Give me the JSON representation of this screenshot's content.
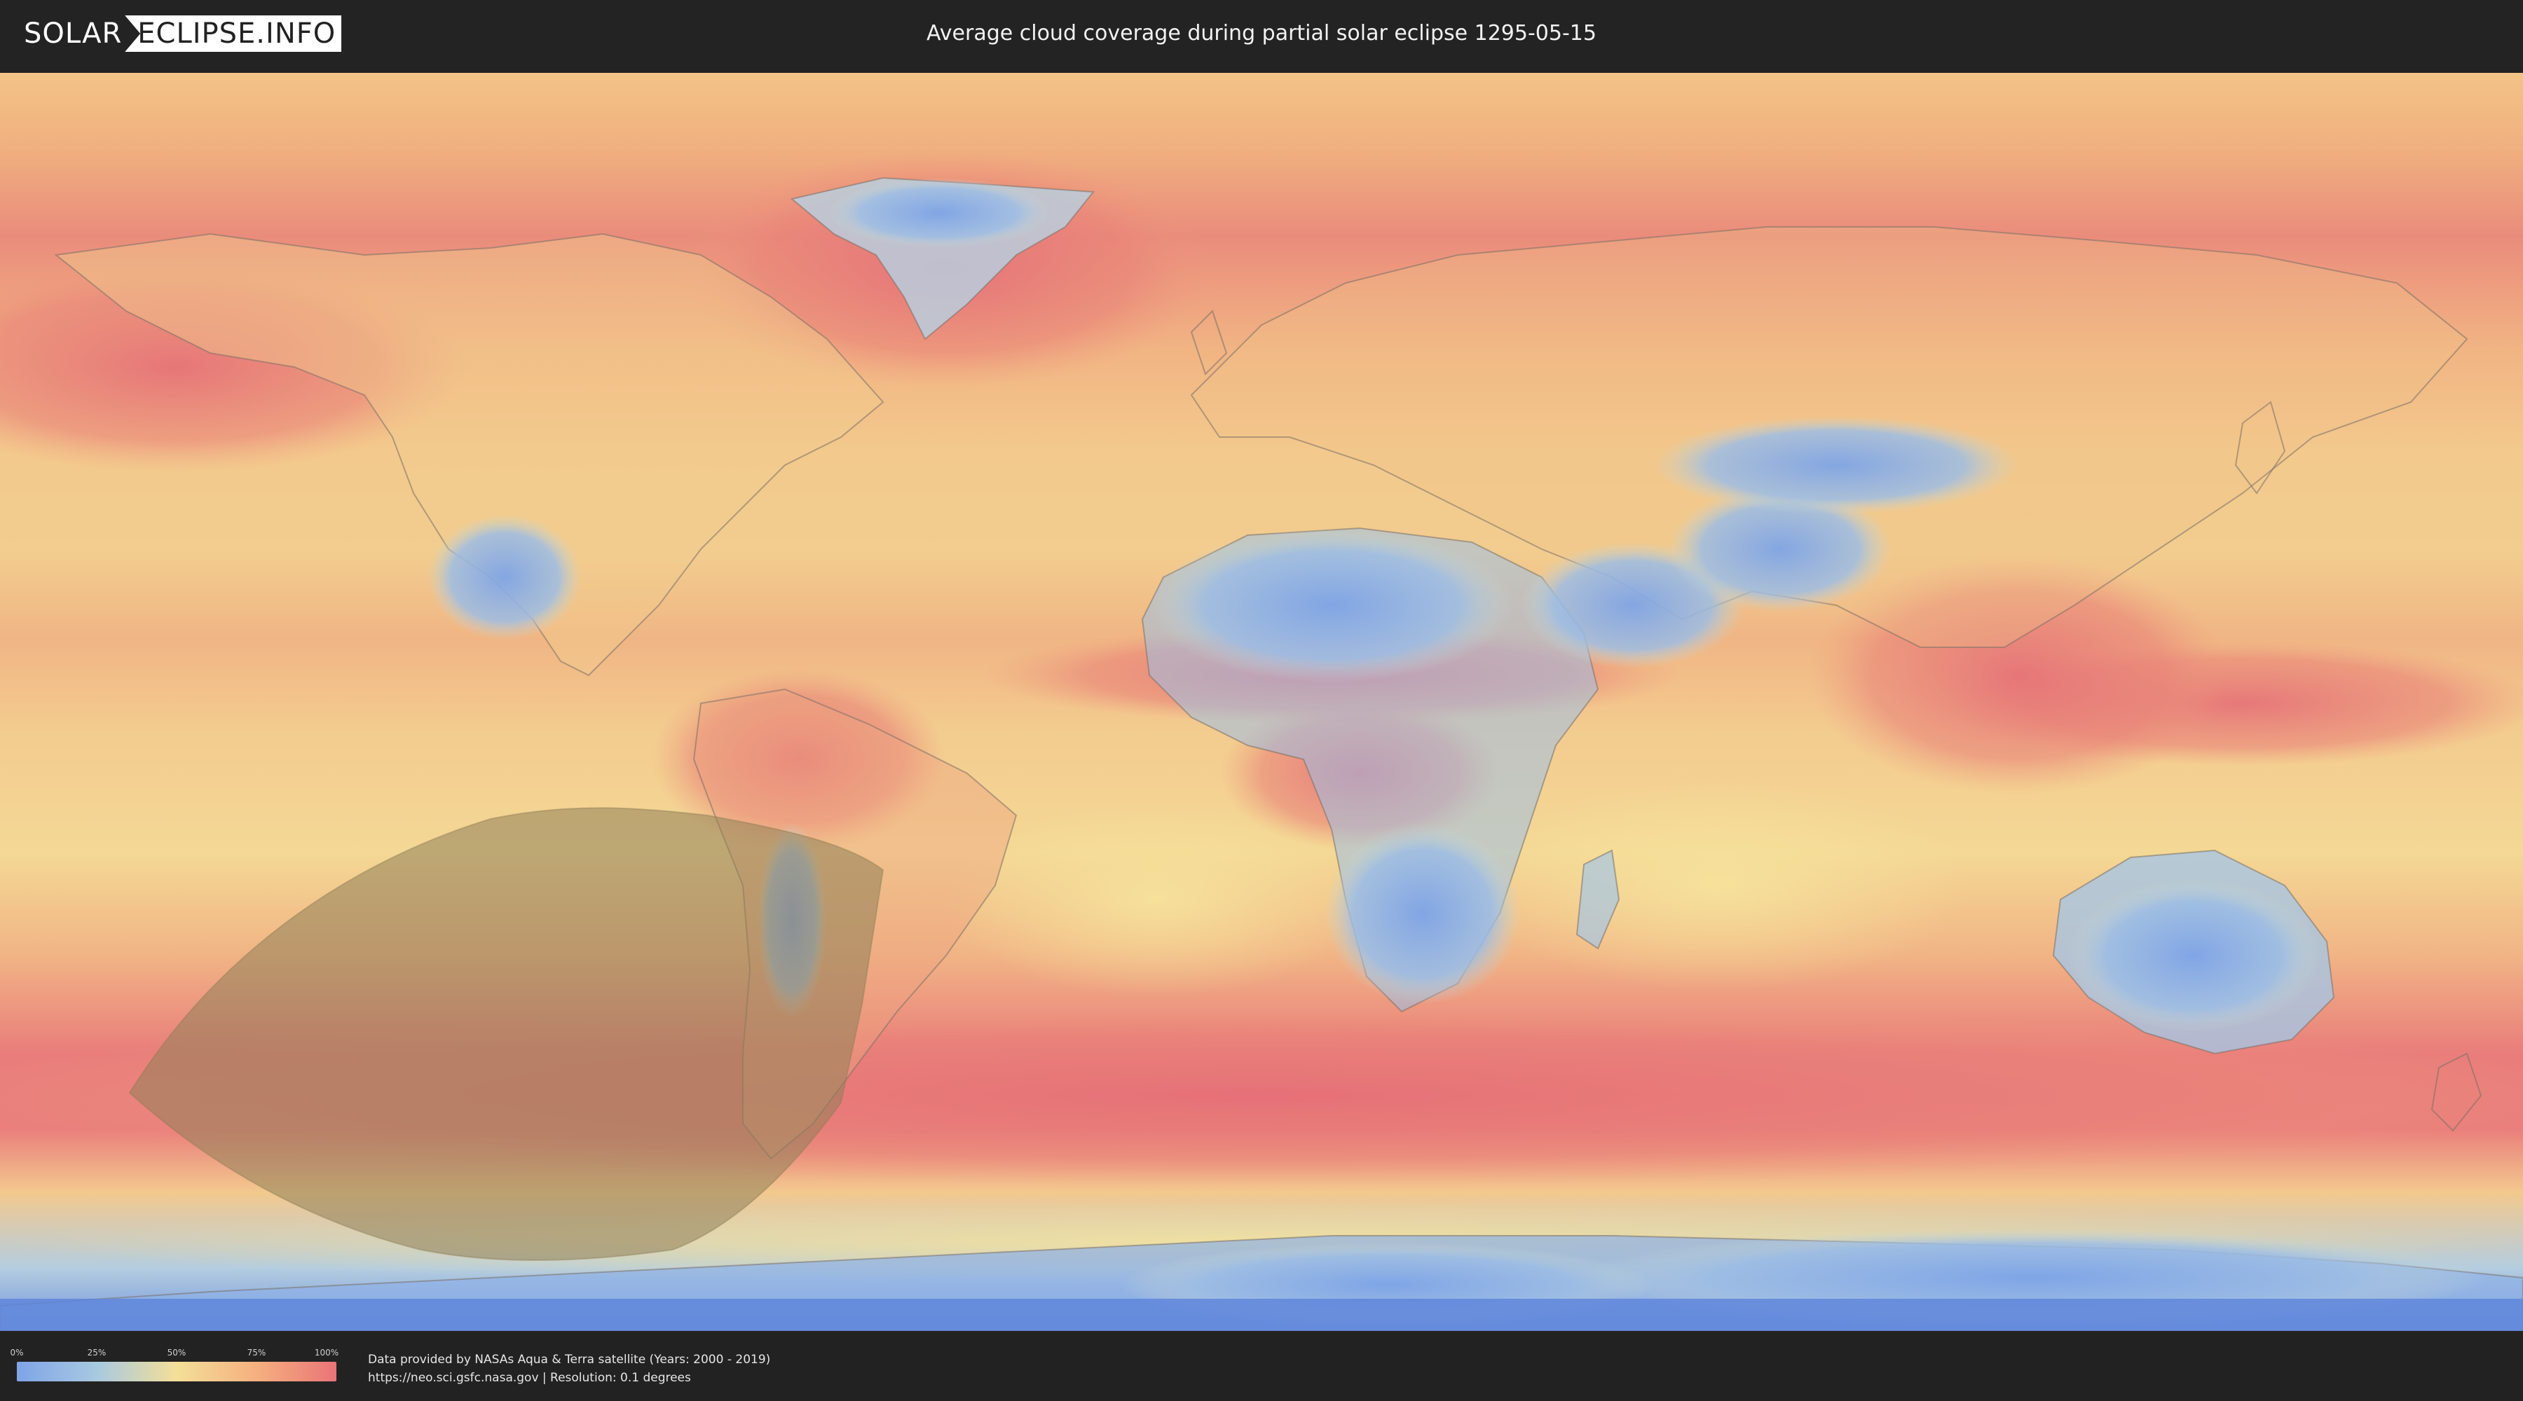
{
  "header": {
    "logo_left": "SOLAR",
    "logo_right": "ECLIPSE.INFO",
    "title": "Average cloud coverage during partial solar eclipse 1295-05-15"
  },
  "map": {
    "type": "cloud-coverage-world-map",
    "projection": "equirectangular",
    "eclipse_visibility_region": "south-eastern Pacific and southern South America",
    "colors": {
      "low": "#7fa6e6",
      "mid_low": "#a9cbe2",
      "mid": "#f2dd9a",
      "mid_high": "#f3b97f",
      "high": "#e8787a",
      "eclipse_overlay": "#9b8a60"
    }
  },
  "legend": {
    "ticks": [
      {
        "label": "0%",
        "pos": 0
      },
      {
        "label": "25%",
        "pos": 0.25
      },
      {
        "label": "50%",
        "pos": 0.5
      },
      {
        "label": "75%",
        "pos": 0.75
      },
      {
        "label": "100%",
        "pos": 1
      }
    ],
    "gradient": [
      "#7fa4e8",
      "#a8c9e0",
      "#f4df98",
      "#f5b07f",
      "#ea7478"
    ]
  },
  "footer": {
    "credit_line1": "Data provided by NASAs Aqua & Terra satellite (Years: 2000 - 2019)",
    "credit_line2": "https://neo.sci.gsfc.nasa.gov | Resolution: 0.1 degrees"
  }
}
